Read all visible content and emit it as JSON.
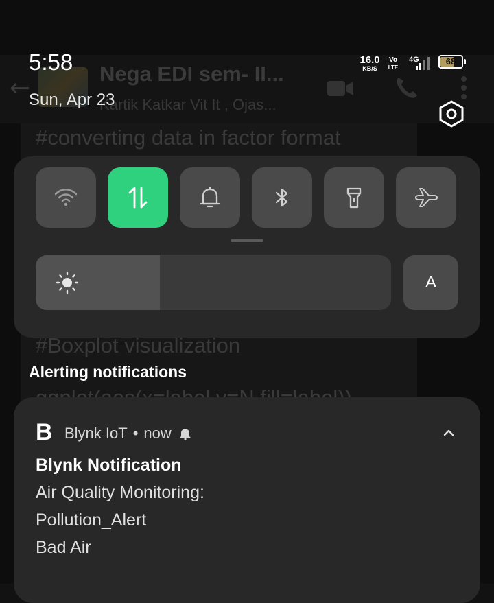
{
  "background_app": {
    "title": "Nega EDI sem- II...",
    "subtitle": "Kartik Katkar Vit It , Ojas...",
    "code_lines": [
      "#converting data in factor format",
      "#Boxplot visualization",
      "ggplot(aes(x=label,y=N,fill=label))"
    ]
  },
  "status_bar": {
    "time": "5:58",
    "date": "Sun, Apr 23",
    "net_speed_value": "16.0",
    "net_speed_unit": "KB/S",
    "volte_top": "Vo",
    "volte_bottom": "LTE",
    "network_type": "4G",
    "battery_level": "68",
    "battery_fraction": 0.68
  },
  "quick_settings": {
    "tiles": [
      {
        "name": "wifi",
        "icon": "wifi-icon",
        "active": false
      },
      {
        "name": "mobile-data",
        "icon": "data-arrows-icon",
        "active": true
      },
      {
        "name": "sound",
        "icon": "bell-icon",
        "active": false
      },
      {
        "name": "bluetooth",
        "icon": "bluetooth-icon",
        "active": false
      },
      {
        "name": "flashlight",
        "icon": "flashlight-icon",
        "active": false
      },
      {
        "name": "airplane-mode",
        "icon": "airplane-icon",
        "active": false
      }
    ],
    "brightness_level": 0.35,
    "auto_brightness_label": "A"
  },
  "notifications": {
    "section_label": "Alerting notifications",
    "items": [
      {
        "app_icon_letter": "B",
        "app_name": "Blynk IoT",
        "separator": "•",
        "time": "now",
        "title": "Blynk Notification",
        "lines": [
          "Air Quality Monitoring:",
          "Pollution_Alert",
          "Bad Air"
        ]
      }
    ]
  },
  "colors": {
    "accent_active_tile": "#2fd17f",
    "panel": "#282828",
    "tile": "#4a4a4a"
  }
}
